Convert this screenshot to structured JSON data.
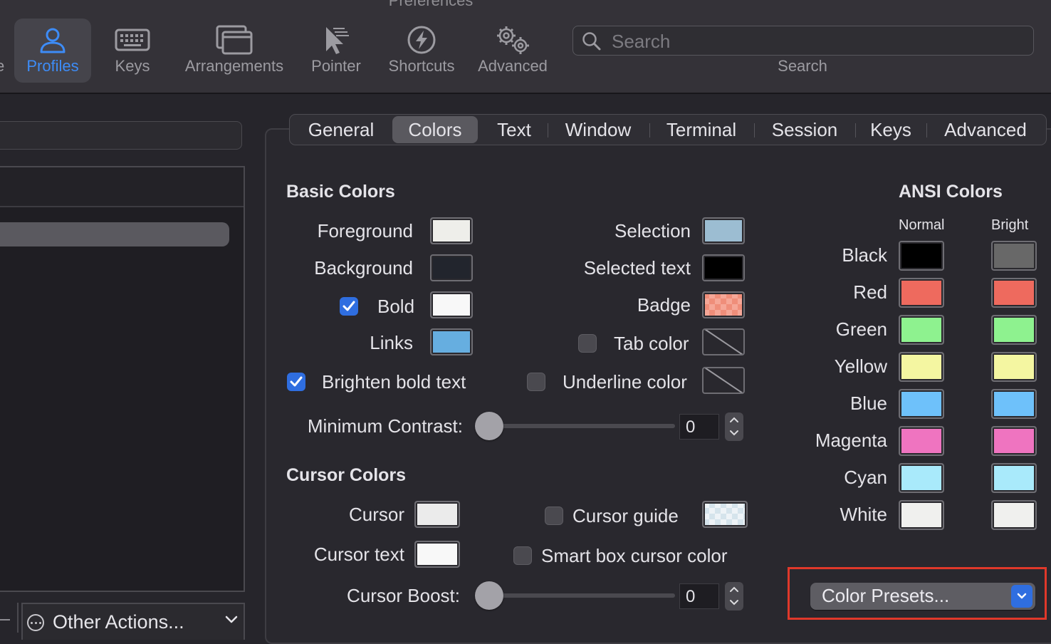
{
  "window": {
    "title": "Preferences"
  },
  "toolbar": {
    "cut_item_label": "e",
    "items": [
      {
        "label": "Profiles",
        "icon": "person-icon",
        "selected": true
      },
      {
        "label": "Keys",
        "icon": "keyboard-icon",
        "selected": false
      },
      {
        "label": "Arrangements",
        "icon": "windows-icon",
        "selected": false
      },
      {
        "label": "Pointer",
        "icon": "pointer-icon",
        "selected": false
      },
      {
        "label": "Shortcuts",
        "icon": "bolt-icon",
        "selected": false
      },
      {
        "label": "Advanced",
        "icon": "gears-icon",
        "selected": false
      }
    ],
    "search": {
      "placeholder": "Search",
      "value": "",
      "caption": "Search"
    },
    "accent": "#3d8cf7"
  },
  "left_pane": {
    "other_actions_label": "Other Actions..."
  },
  "tabs": {
    "items": [
      "General",
      "Colors",
      "Text",
      "Window",
      "Terminal",
      "Session",
      "Keys",
      "Advanced"
    ],
    "active": "Colors"
  },
  "basic_colors": {
    "title": "Basic Colors",
    "foreground": {
      "label": "Foreground",
      "color": "#eeeeea"
    },
    "background": {
      "label": "Background",
      "color": "#22252d"
    },
    "bold": {
      "label": "Bold",
      "checked": true,
      "color": "#f8f8f8"
    },
    "links": {
      "label": "Links",
      "color": "#66aee0"
    },
    "selection": {
      "label": "Selection",
      "color": "#9cbdd2"
    },
    "selected_text": {
      "label": "Selected text",
      "color": "#000000"
    },
    "badge": {
      "label": "Badge",
      "color": "#ef8e7a"
    },
    "tab_color": {
      "label": "Tab color",
      "checked": false
    },
    "brighten_bold": {
      "label": "Brighten bold text",
      "checked": true
    },
    "underline_color": {
      "label": "Underline color",
      "checked": false
    },
    "minimum_contrast": {
      "label": "Minimum Contrast:",
      "value": "0"
    }
  },
  "cursor_colors": {
    "title": "Cursor Colors",
    "cursor": {
      "label": "Cursor",
      "color": "#ebebeb"
    },
    "cursor_text": {
      "label": "Cursor text",
      "color": "#f8f8f8"
    },
    "cursor_guide": {
      "label": "Cursor guide",
      "checked": false
    },
    "smart_box": {
      "label": "Smart box cursor color",
      "checked": false
    },
    "cursor_boost": {
      "label": "Cursor Boost:",
      "value": "0"
    }
  },
  "ansi_colors": {
    "title": "ANSI Colors",
    "normal_header": "Normal",
    "bright_header": "Bright",
    "rows": [
      {
        "name": "Black",
        "normal": "#000000",
        "bright": "#686868"
      },
      {
        "name": "Red",
        "normal": "#ee6a5e",
        "bright": "#ee6a5e"
      },
      {
        "name": "Green",
        "normal": "#8ef28f",
        "bright": "#8ef28f"
      },
      {
        "name": "Yellow",
        "normal": "#f4f6a1",
        "bright": "#f4f6a1"
      },
      {
        "name": "Blue",
        "normal": "#6ec1fa",
        "bright": "#6ec1fa"
      },
      {
        "name": "Magenta",
        "normal": "#ef74c0",
        "bright": "#ef74c0"
      },
      {
        "name": "Cyan",
        "normal": "#a9eafb",
        "bright": "#a9eafb"
      },
      {
        "name": "White",
        "normal": "#f0f0ee",
        "bright": "#f0f0ee"
      }
    ]
  },
  "presets": {
    "label": "Color Presets..."
  },
  "highlight_color": "#e0382a"
}
